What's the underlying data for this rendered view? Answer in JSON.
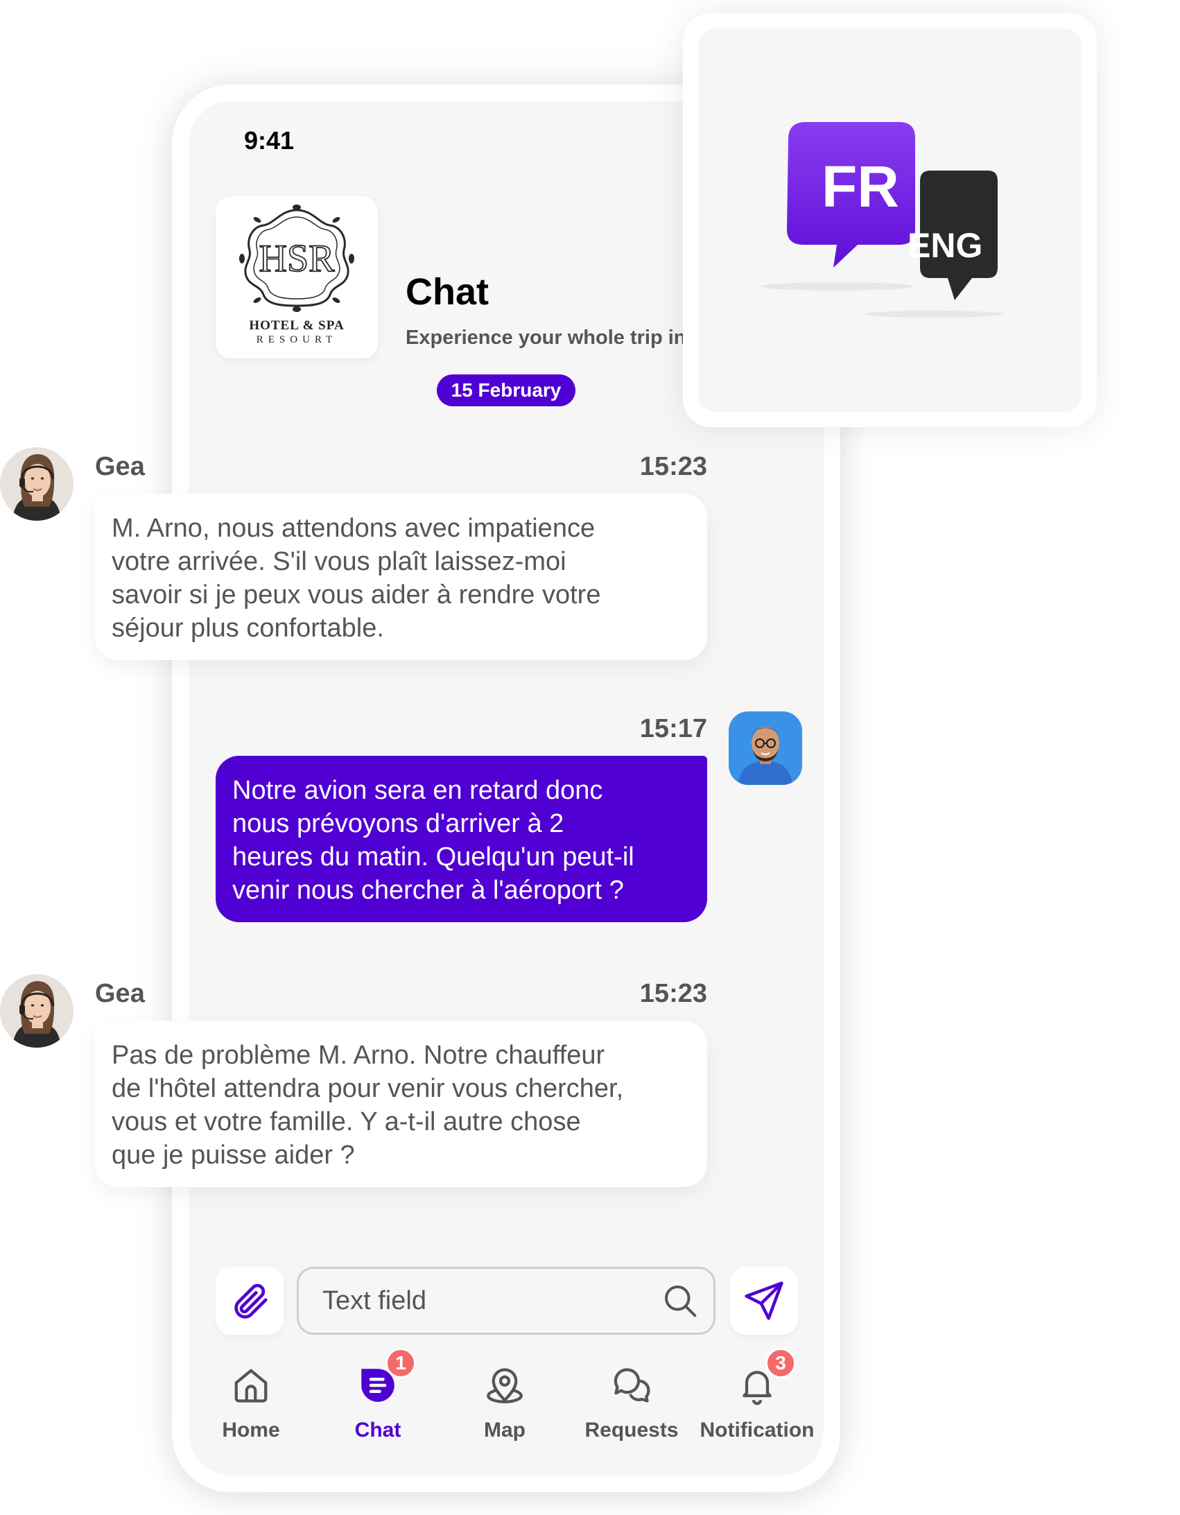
{
  "status_bar": {
    "time": "9:41"
  },
  "header": {
    "logo": {
      "monogram": "HSR",
      "line1": "HOTEL & SPA",
      "line2": "RESOURT"
    },
    "title": "Chat",
    "subtitle": "Experience your whole trip in"
  },
  "date_separator": "15 February",
  "messages": [
    {
      "sender": "Gea",
      "time": "15:23",
      "direction": "incoming",
      "lines": [
        "M. Arno, nous attendons avec impatience",
        "votre arrivée. S'il vous plaît laissez-moi",
        "savoir si je peux vous aider à rendre votre",
        "séjour plus confortable."
      ]
    },
    {
      "sender": "",
      "time": "15:17",
      "direction": "outgoing",
      "lines": [
        "Notre avion sera en retard donc",
        "nous prévoyons d'arriver à 2",
        "heures du matin. Quelqu'un peut-il",
        "venir nous chercher à l'aéroport ?"
      ]
    },
    {
      "sender": "Gea",
      "time": "15:23",
      "direction": "incoming",
      "lines": [
        "Pas de problème M. Arno. Notre chauffeur",
        "de l'hôtel attendra pour venir vous chercher,",
        "vous et votre famille. Y a-t-il autre chose",
        "que je puisse aider ?"
      ]
    }
  ],
  "composer": {
    "placeholder": "Text field",
    "attach_icon": "paperclip-icon",
    "search_icon": "search-icon",
    "send_icon": "send-icon"
  },
  "bottom_nav": {
    "items": [
      {
        "label": "Home",
        "icon": "home-icon",
        "active": false,
        "badge": null
      },
      {
        "label": "Chat",
        "icon": "chat-icon",
        "active": true,
        "badge": "1"
      },
      {
        "label": "Map",
        "icon": "map-pin-icon",
        "active": false,
        "badge": null
      },
      {
        "label": "Requests",
        "icon": "requests-icon",
        "active": false,
        "badge": null
      },
      {
        "label": "Notification",
        "icon": "bell-icon",
        "active": false,
        "badge": "3"
      }
    ]
  },
  "language_card": {
    "from": "FR",
    "to": "ENG"
  },
  "colors": {
    "accent": "#5000d2",
    "badge": "#f26a6a",
    "screen_bg": "#f6f6f6",
    "text_muted": "#555555"
  }
}
